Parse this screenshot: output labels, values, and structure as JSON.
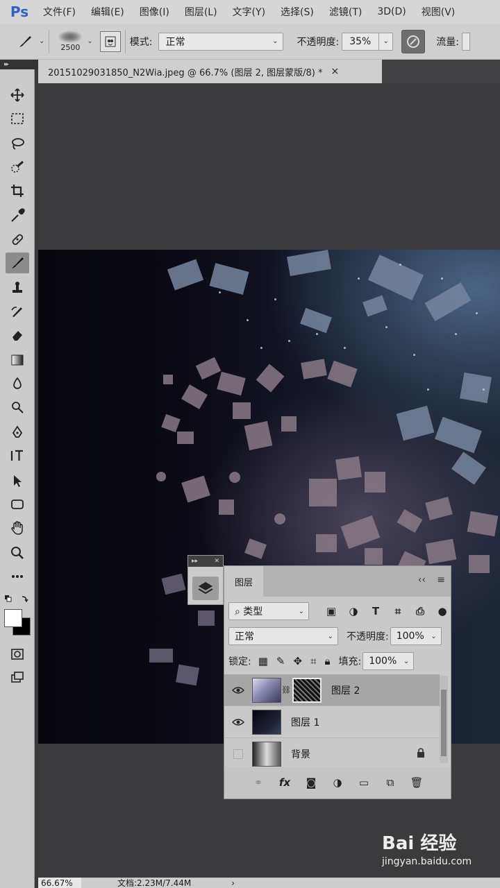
{
  "app": {
    "logo": "Ps"
  },
  "menu": [
    "文件(F)",
    "编辑(E)",
    "图像(I)",
    "图层(L)",
    "文字(Y)",
    "选择(S)",
    "滤镜(T)",
    "3D(D)",
    "视图(V)"
  ],
  "options": {
    "brush_size": "2500",
    "mode_label": "模式:",
    "mode_value": "正常",
    "opacity_label": "不透明度:",
    "opacity_value": "35%",
    "flow_label": "流量:"
  },
  "document": {
    "tab_title": "20151029031850_N2Wia.jpeg @ 66.7% (图层 2, 图层蒙版/8) *",
    "close": "×"
  },
  "status": {
    "zoom": "66.67%",
    "doc_info": "文档:2.23M/7.44M",
    "arrow": "›"
  },
  "layers_panel": {
    "tab": "图层",
    "collapse": "‹‹",
    "menu": "≡",
    "filter_kind": "类型",
    "blend_mode": "正常",
    "opacity_label": "不透明度:",
    "opacity_value": "100%",
    "lock_label": "锁定:",
    "fill_label": "填充:",
    "fill_value": "100%",
    "layers": [
      {
        "name": "图层 2",
        "visible": true,
        "selected": true
      },
      {
        "name": "图层 1",
        "visible": true,
        "selected": false
      },
      {
        "name": "背景",
        "visible": false,
        "selected": false,
        "locked": true
      }
    ]
  },
  "watermark": {
    "main": "Bai 经验",
    "sub": "jingyan.baidu.com"
  },
  "colors": {
    "accent": "#2b63c9",
    "canvas_bg": "#3b3a3c",
    "panel_bg": "#c9c9c9"
  }
}
